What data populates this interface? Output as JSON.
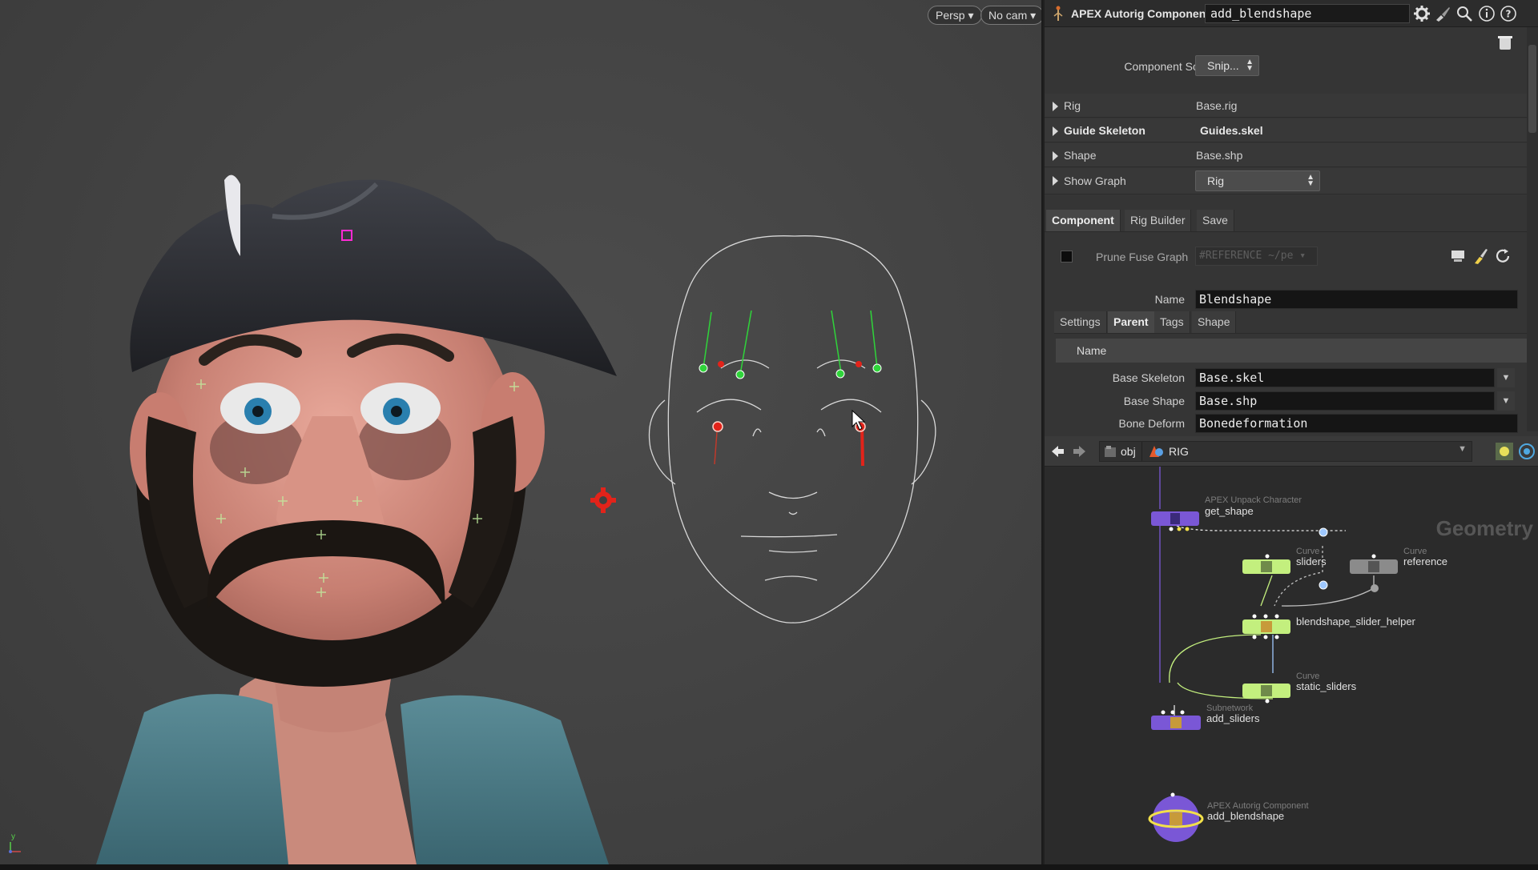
{
  "viewport": {
    "camera_mode": "Persp",
    "camera": "No cam",
    "axis_label": "y"
  },
  "parameters": {
    "node_type": "APEX Autorig Component",
    "node_name": "add_blendshape",
    "component_source": {
      "label": "Component Source",
      "value": "Snip..."
    },
    "folders": [
      {
        "label": "Rig",
        "value": "Base.rig",
        "bold": false
      },
      {
        "label": "Guide Skeleton",
        "value": "Guides.skel",
        "bold": true
      },
      {
        "label": "Shape",
        "value": "Base.shp",
        "bold": false
      },
      {
        "label": "Show Graph",
        "value": "Rig",
        "bold": false
      }
    ],
    "tabs": [
      "Component",
      "Rig Builder",
      "Save"
    ],
    "prune_fuse_graph": {
      "label": "Prune Fuse Graph",
      "placeholder": "#REFERENCE ~/pe"
    },
    "name": {
      "label": "Name",
      "value": "Blendshape"
    },
    "subtabs": [
      "Settings",
      "Parent",
      "Tags",
      "Shape"
    ],
    "table_header": "Name",
    "base_skeleton": {
      "label": "Base Skeleton",
      "value": "Base.skel"
    },
    "base_shape": {
      "label": "Base Shape",
      "value": "Base.shp"
    },
    "bone_deform": {
      "label": "Bone Deform",
      "value": "Bonedeformation"
    }
  },
  "network": {
    "path": [
      "obj",
      "RIG"
    ],
    "context_label": "Geometry",
    "nodes": [
      {
        "type": "APEX Unpack Character",
        "name": "get_shape"
      },
      {
        "type": "Curve",
        "name": "sliders"
      },
      {
        "type": "Curve",
        "name": "reference"
      },
      {
        "type": "",
        "name": "blendshape_slider_helper"
      },
      {
        "type": "Curve",
        "name": "static_sliders"
      },
      {
        "type": "Subnetwork",
        "name": "add_sliders"
      },
      {
        "type": "APEX Autorig Component",
        "name": "add_blendshape"
      }
    ]
  },
  "colors": {
    "accent_green": "#c3ef7e",
    "node_purple": "#7a57d6",
    "handle_red": "#e2231a",
    "handle_green": "#2fd43a",
    "selection_yellow": "#f2e04a"
  }
}
